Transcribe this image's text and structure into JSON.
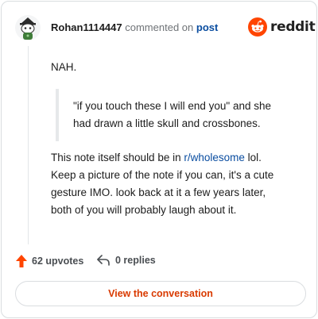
{
  "header": {
    "username": "Rohan1114447",
    "commented_text": "commented on",
    "post_link": "post",
    "brand": "reddit"
  },
  "comment": {
    "line1": "NAH.",
    "quote": [
      "\"if you touch these I will end you\" and she",
      "had drawn a little skull and crossbones."
    ],
    "para_line1_prefix": "This note itself should be in ",
    "para_line1_link": "r/wholesome",
    "para_line1_suffix": " lol.",
    "para_lines": [
      "Keep a picture of the note if you can, it's a cute",
      "gesture IMO. look back at it a few years later,",
      "both of you will probably laugh about it."
    ]
  },
  "actions": {
    "upvotes": "62 upvotes",
    "replies": "0 replies",
    "view_button": "View the conversation"
  },
  "icons": {
    "avatar": "snoo-avatar-icon",
    "brand": "reddit-logo-icon",
    "upvote": "upvote-arrow-icon",
    "reply": "reply-arrow-icon"
  },
  "colors": {
    "brand_orange": "#ff4500",
    "link_blue": "#0a4da0",
    "button_text": "#d93a00"
  }
}
